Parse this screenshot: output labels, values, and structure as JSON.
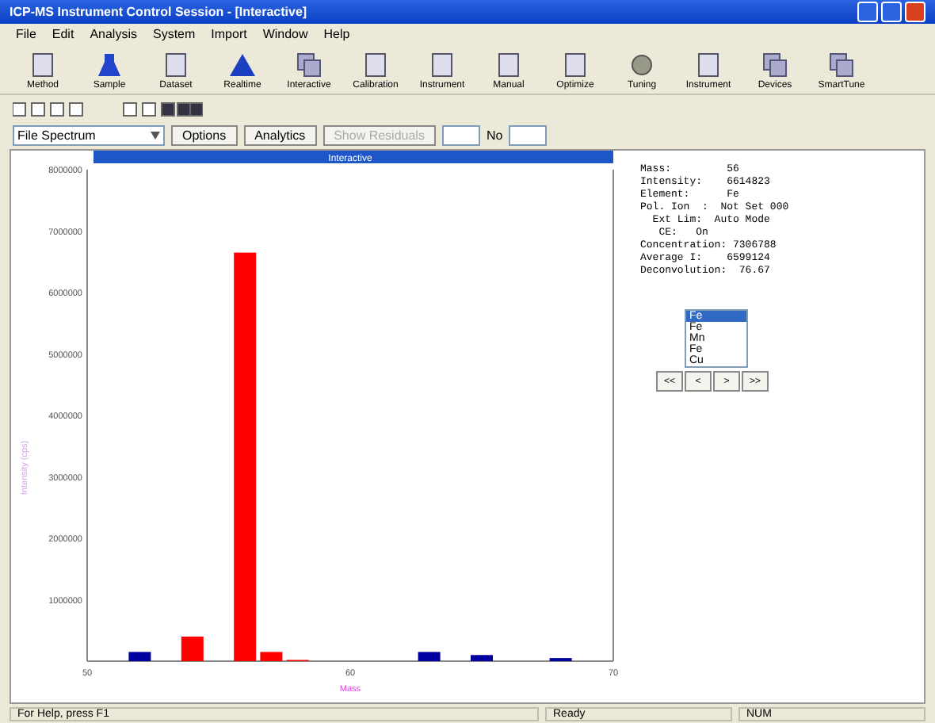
{
  "window": {
    "title": "ICP-MS Instrument Control Session - [Interactive]"
  },
  "menu": [
    "File",
    "Edit",
    "Analysis",
    "System",
    "Import",
    "Window",
    "Help"
  ],
  "toolbar": [
    "Method",
    "Sample",
    "Dataset",
    "Realtime",
    "Interactive",
    "Calibration",
    "Instrument",
    "Manual",
    "Optimize",
    "Tuning",
    "Instrument",
    "Devices",
    "SmartTune"
  ],
  "spectrum_select": {
    "value": "File Spectrum"
  },
  "buttons": [
    {
      "label": "Options",
      "disabled": false
    },
    {
      "label": "Analytics",
      "disabled": false
    },
    {
      "label": "Show Residuals",
      "disabled": true
    }
  ],
  "no_label": "No",
  "chart": {
    "title": "Interactive",
    "chart_data": {
      "type": "bar",
      "xlabel": "Mass",
      "ylabel": "Intensity (cps)",
      "x": [
        52,
        54,
        56,
        57,
        58,
        63,
        65,
        68
      ],
      "series": [
        {
          "color": "#ff0000",
          "values": [
            null,
            400000,
            6650000,
            150000,
            20000,
            null,
            null,
            null
          ]
        },
        {
          "color": "#0000a0",
          "values": [
            150000,
            null,
            null,
            null,
            null,
            150000,
            100000,
            50000
          ]
        }
      ],
      "xlim": [
        50,
        70
      ],
      "ylim": [
        0,
        8000000
      ],
      "xticks": [
        50,
        60,
        70
      ],
      "yticks": [
        1000000,
        2000000,
        3000000,
        4000000,
        5000000,
        6000000,
        7000000,
        8000000
      ]
    }
  },
  "info": [
    "Mass:         56",
    "Intensity:    6614823",
    "Element:      Fe",
    "Pol. Ion  :  Not Set 000",
    "  Ext Lim:  Auto Mode",
    "   CE:   On",
    "Concentration: 7306788",
    "Average I:    6599124",
    "Deconvolution:  76.67"
  ],
  "element_list": [
    {
      "label": "Fe",
      "selected": true
    },
    {
      "label": "Fe",
      "selected": false
    },
    {
      "label": "Mn",
      "selected": false
    },
    {
      "label": "Fe",
      "selected": false
    },
    {
      "label": "Cu",
      "selected": false
    }
  ],
  "nav_buttons": [
    "<<",
    "<",
    ">",
    ">>"
  ],
  "status_bar": [
    "For Help, press F1",
    "Ready",
    "NUM"
  ]
}
